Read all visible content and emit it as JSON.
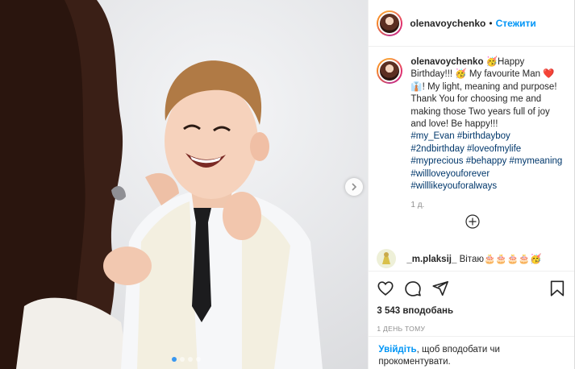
{
  "header": {
    "username": "olenavoychenko",
    "separator": "•",
    "follow_label": "Стежити"
  },
  "caption": {
    "username": "olenavoychenko",
    "text": "🥳Happy Birthday!!! 🥳 My favourite Man ❤️ 👔! My light, meaning and purpose! Thank You for choosing me and making those Two years full of joy and love! Be happy!!!",
    "hashtags": "#my_Evan #birthdayboy #2ndbirthday #loveofmylife #myprecious #behappy #mymeaning #willloveyouforever #willlikeyouforalways",
    "time": "1 д."
  },
  "comment": {
    "username": "_m.plaksij_",
    "text": "Вітаю🎂🎂🎂🎂🥳"
  },
  "actions": {
    "likes": "3 543 вподобань",
    "date": "1 ДЕНЬ ТОМУ"
  },
  "login": {
    "link": "Увійдіть",
    "text": ", щоб вподобати чи прокоментувати."
  },
  "carousel": {
    "slides": 4,
    "active": 1
  },
  "colors": {
    "link": "#0095f6",
    "hashtag": "#00376b",
    "secondary": "#8e8e8e",
    "dot_active": "#3897f0"
  },
  "icons": {
    "next": "chevron-right-icon",
    "like": "heart-icon",
    "comment": "comment-icon",
    "share": "share-icon",
    "save": "bookmark-icon",
    "load_more": "plus-circle-icon"
  }
}
